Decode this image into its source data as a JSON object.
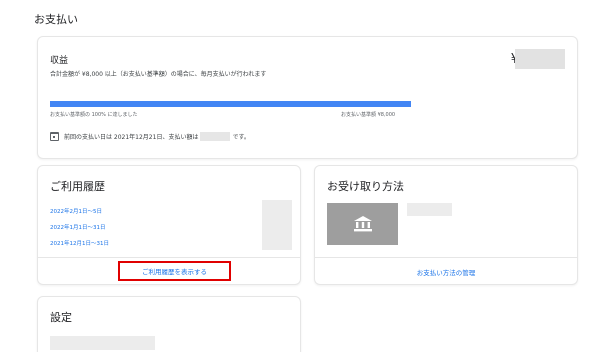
{
  "page": {
    "title": "お支払い"
  },
  "earnings": {
    "title": "収益",
    "description": "合計金額が ¥8,000 以上（お支払い基準額）の場合に、毎月支払いが行われます",
    "currency_symbol": "¥",
    "progress_percent": 100,
    "progress_left_label": "お支払い基準額の 100% に達しました",
    "progress_right_label": "お支払い基準額 ¥8,000",
    "next_payment_prefix": "前回の支払い日は 2021年12月21日、支払い額は",
    "next_payment_suffix": "です。"
  },
  "history": {
    "title": "ご利用履歴",
    "items": [
      "2022年2月1日～5日",
      "2022年1月1日～31日",
      "2021年12月1日～31日"
    ],
    "view_link": "ご利用履歴を表示する"
  },
  "receive": {
    "title": "お受け取り方法",
    "manage_link": "お支払い方法の管理",
    "icon": "bank-icon"
  },
  "settings": {
    "title": "設定"
  },
  "colors": {
    "accent": "#1a73e8",
    "progress": "#4285f4",
    "highlight": "#e00000"
  }
}
